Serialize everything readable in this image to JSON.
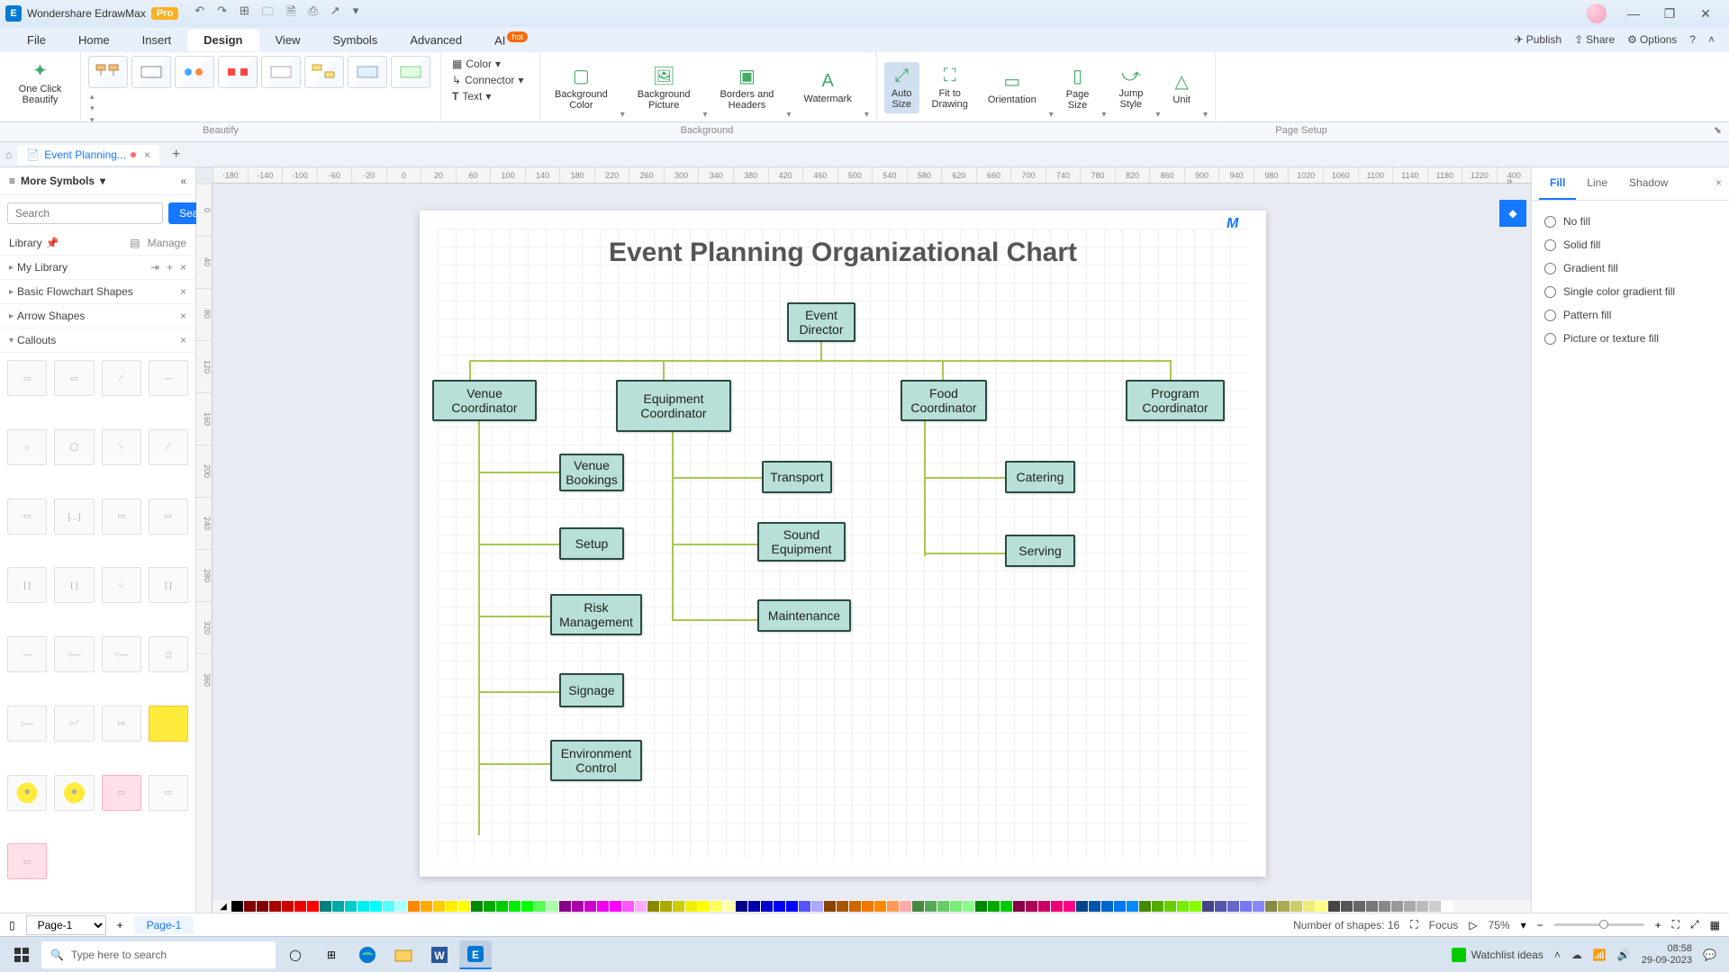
{
  "app": {
    "title": "Wondershare EdrawMax",
    "pro": "Pro"
  },
  "menu": {
    "items": [
      "File",
      "Home",
      "Insert",
      "Design",
      "View",
      "Symbols",
      "Advanced"
    ],
    "ai": "AI",
    "ai_badge": "hot",
    "active": "Design",
    "right": {
      "publish": "Publish",
      "share": "Share",
      "options": "Options"
    }
  },
  "ribbon": {
    "oneclick": "One Click\nBeautify",
    "color": "Color",
    "connector": "Connector",
    "text": "Text",
    "bgcolor": "Background\nColor",
    "bgpic": "Background\nPicture",
    "borders": "Borders and\nHeaders",
    "watermark": "Watermark",
    "autosize": "Auto\nSize",
    "fit": "Fit to\nDrawing",
    "orientation": "Orientation",
    "pagesize": "Page\nSize",
    "jump": "Jump\nStyle",
    "unit": "Unit",
    "groups": {
      "beautify": "Beautify",
      "background": "Background",
      "pagesetup": "Page Setup"
    }
  },
  "doctab": {
    "name": "Event Planning..."
  },
  "leftpanel": {
    "title": "More Symbols",
    "search_ph": "Search",
    "search_btn": "Search",
    "library": "Library",
    "manage": "Manage",
    "mylib": "My Library",
    "cats": [
      "Basic Flowchart Shapes",
      "Arrow Shapes",
      "Callouts"
    ]
  },
  "ruler_h": [
    "-180",
    "-140",
    "-100",
    "-60",
    "-20",
    "0",
    "20",
    "60",
    "100",
    "140",
    "180",
    "220",
    "260",
    "300",
    "340",
    "380",
    "420",
    "460",
    "500",
    "540",
    "580",
    "620",
    "660",
    "700",
    "740",
    "780",
    "820",
    "860",
    "900",
    "940",
    "980",
    "1020",
    "1060",
    "1100",
    "1140",
    "1180",
    "1220",
    "400"
  ],
  "ruler_v": [
    "0",
    "40",
    "80",
    "120",
    "160",
    "200",
    "240",
    "280",
    "320",
    "360"
  ],
  "chart": {
    "title": "Event Planning Organizational Chart",
    "boxes": {
      "director": "Event\nDirector",
      "venue": "Venue\nCoordinator",
      "equip": "Equipment\nCoordinator",
      "food": "Food\nCoordinator",
      "program": "Program\nCoordinator",
      "bookings": "Venue\nBookings",
      "setup": "Setup",
      "risk": "Risk\nManagement",
      "signage": "Signage",
      "env": "Environment\nControl",
      "transport": "Transport",
      "sound": "Sound\nEquipment",
      "maint": "Maintenance",
      "catering": "Catering",
      "serving": "Serving"
    }
  },
  "rightpanel": {
    "tabs": {
      "fill": "Fill",
      "line": "Line",
      "shadow": "Shadow"
    },
    "opts": [
      "No fill",
      "Solid fill",
      "Gradient fill",
      "Single color gradient fill",
      "Pattern fill",
      "Picture or texture fill"
    ]
  },
  "status": {
    "page": "Page-1",
    "page_tab": "Page-1",
    "shapes": "Number of shapes: 16",
    "focus": "Focus",
    "zoom": "75%"
  },
  "taskbar": {
    "search": "Type here to search",
    "watchlist": "Watchlist ideas",
    "time": "08:58",
    "date": "29-09-2023"
  },
  "colors": [
    "#000",
    "#7f0000",
    "#800000",
    "#a00",
    "#c00",
    "#e00",
    "#f00",
    "#008080",
    "#0aa",
    "#0cc",
    "#0ee",
    "#0ff",
    "#5ff",
    "#aff",
    "#f80",
    "#fa0",
    "#fc0",
    "#fe0",
    "#ff0",
    "#080",
    "#0a0",
    "#0c0",
    "#0e0",
    "#0f0",
    "#5f5",
    "#afa",
    "#808",
    "#a0a",
    "#c0c",
    "#e0e",
    "#f0f",
    "#f5f",
    "#faf",
    "#880",
    "#aa0",
    "#cc0",
    "#ee0",
    "#ff0",
    "#ff5",
    "#ffa",
    "#008",
    "#00a",
    "#00c",
    "#00e",
    "#00f",
    "#55f",
    "#aaf",
    "#840",
    "#a50",
    "#c60",
    "#e70",
    "#f80",
    "#f95",
    "#faa",
    "#484",
    "#5a5",
    "#6c6",
    "#7e7",
    "#8f8",
    "#080",
    "#0a0",
    "#0c0",
    "#804",
    "#a05",
    "#c06",
    "#e07",
    "#f08",
    "#048",
    "#05a",
    "#06c",
    "#07e",
    "#08f",
    "#480",
    "#5a0",
    "#6c0",
    "#7e0",
    "#8f0",
    "#448",
    "#55a",
    "#66c",
    "#77e",
    "#88f",
    "#884",
    "#aa5",
    "#cc6",
    "#ee7",
    "#ff8",
    "#444",
    "#555",
    "#666",
    "#777",
    "#888",
    "#999",
    "#aaa",
    "#bbb",
    "#ccc",
    "#fff"
  ]
}
